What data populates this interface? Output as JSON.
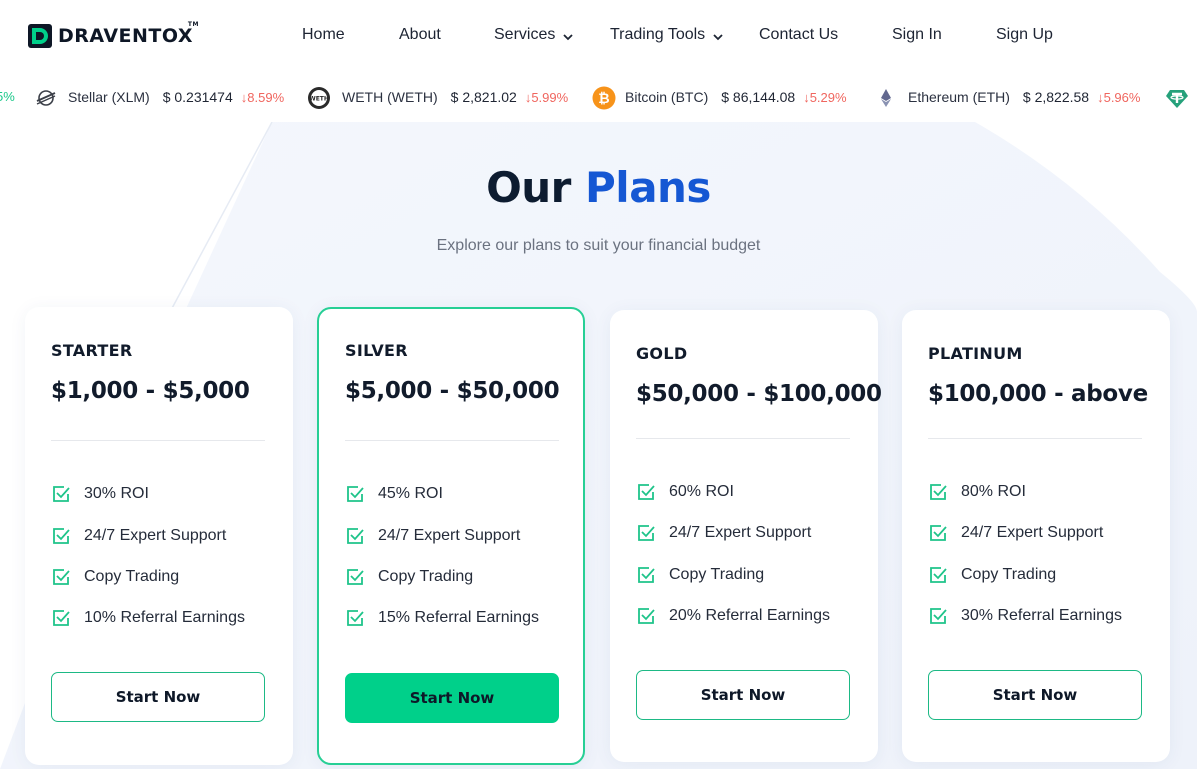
{
  "brand": {
    "name": "DRAVENTOX",
    "tm": "TM",
    "logo_icon": "d-logo-icon"
  },
  "nav": {
    "items": [
      {
        "label": "Home"
      },
      {
        "label": "About"
      },
      {
        "label": "Services",
        "has_dropdown": true
      },
      {
        "label": "Trading Tools",
        "has_dropdown": true
      },
      {
        "label": "Contact Us"
      },
      {
        "label": "Sign In"
      },
      {
        "label": "Sign Up"
      }
    ]
  },
  "ticker": [
    {
      "partial_change": "5%",
      "direction": "up"
    },
    {
      "name": "Stellar (XLM)",
      "price": "$ 0.231474",
      "change": "8.59%",
      "direction": "down",
      "icon": "stellar-icon"
    },
    {
      "name": "WETH (WETH)",
      "price": "$ 2,821.02",
      "change": "5.99%",
      "direction": "down",
      "icon": "weth-icon"
    },
    {
      "name": "Bitcoin (BTC)",
      "price": "$ 86,144.08",
      "change": "5.29%",
      "direction": "down",
      "icon": "bitcoin-icon"
    },
    {
      "name": "Ethereum (ETH)",
      "price": "$ 2,822.58",
      "change": "5.96%",
      "direction": "down",
      "icon": "ethereum-icon"
    },
    {
      "icon": "tether-icon"
    }
  ],
  "section": {
    "title_part1": "Our",
    "title_part2": "Plans",
    "subtitle": "Explore our plans to suit your financial budget"
  },
  "plans": [
    {
      "name": "STARTER",
      "range": "$1,000 - $5,000",
      "features": [
        "30% ROI",
        "24/7 Expert Support",
        "Copy Trading",
        "10% Referral Earnings"
      ],
      "button": "Start Now",
      "featured": false
    },
    {
      "name": "SILVER",
      "range": "$5,000 - $50,000",
      "features": [
        "45% ROI",
        "24/7 Expert Support",
        "Copy Trading",
        "15% Referral Earnings"
      ],
      "button": "Start Now",
      "featured": true
    },
    {
      "name": "GOLD",
      "range": "$50,000 - $100,000",
      "features": [
        "60% ROI",
        "24/7 Expert Support",
        "Copy Trading",
        "20% Referral Earnings"
      ],
      "button": "Start Now",
      "featured": false
    },
    {
      "name": "PLATINUM",
      "range": "$100,000 - above",
      "features": [
        "80% ROI",
        "24/7 Expert Support",
        "Copy Trading",
        "30% Referral Earnings"
      ],
      "button": "Start Now",
      "featured": false
    }
  ],
  "colors": {
    "accent_blue": "#1557d3",
    "accent_green": "#00d08a",
    "negative": "#f0665f",
    "dark": "#0d1c30"
  }
}
